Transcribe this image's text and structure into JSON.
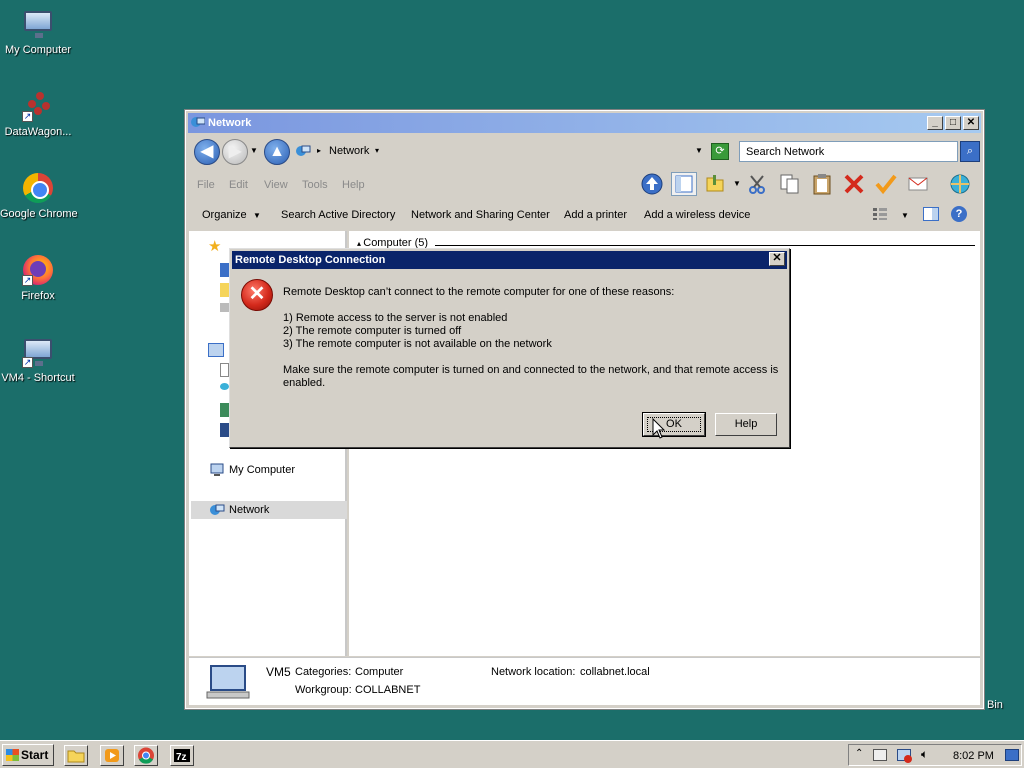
{
  "desktop": {
    "icons": [
      {
        "label": "My Computer"
      },
      {
        "label": "DataWagon..."
      },
      {
        "label": "Google Chrome"
      },
      {
        "label": "Firefox"
      },
      {
        "label": "VM4 - Shortcut"
      }
    ],
    "recycle_bin_partial": "Bin"
  },
  "explorer": {
    "title": "Network",
    "address": "Network",
    "search_placeholder": "Search Network",
    "menu": [
      "File",
      "Edit",
      "View",
      "Tools",
      "Help"
    ],
    "commands": [
      "Organize",
      "Search Active Directory",
      "Network and Sharing Center",
      "Add a printer",
      "Add a wireless device"
    ],
    "nav": {
      "favorites": "Favorites",
      "my_computer": "My Computer",
      "network": "Network"
    },
    "group_header": "Computer (5)",
    "details": {
      "name": "VM5",
      "categories_label": "Categories:",
      "categories_value": "Computer",
      "workgroup_label": "Workgroup:",
      "workgroup_value": "COLLABNET",
      "location_label": "Network location:",
      "location_value": "collabnet.local"
    }
  },
  "dialog": {
    "title": "Remote Desktop Connection",
    "intro": "Remote Desktop can’t connect to the remote computer for one of these reasons:",
    "reasons": [
      "1) Remote access to the server is not enabled",
      "2) The remote computer is turned off",
      "3) The remote computer is not available on the network"
    ],
    "advice_line1": "Make sure the remote computer is turned on and connected to the network, and that remote access is",
    "advice_line2": "enabled.",
    "ok_label": "OK",
    "help_label": "Help"
  },
  "taskbar": {
    "start_label": "Start",
    "clock": "8:02 PM"
  }
}
